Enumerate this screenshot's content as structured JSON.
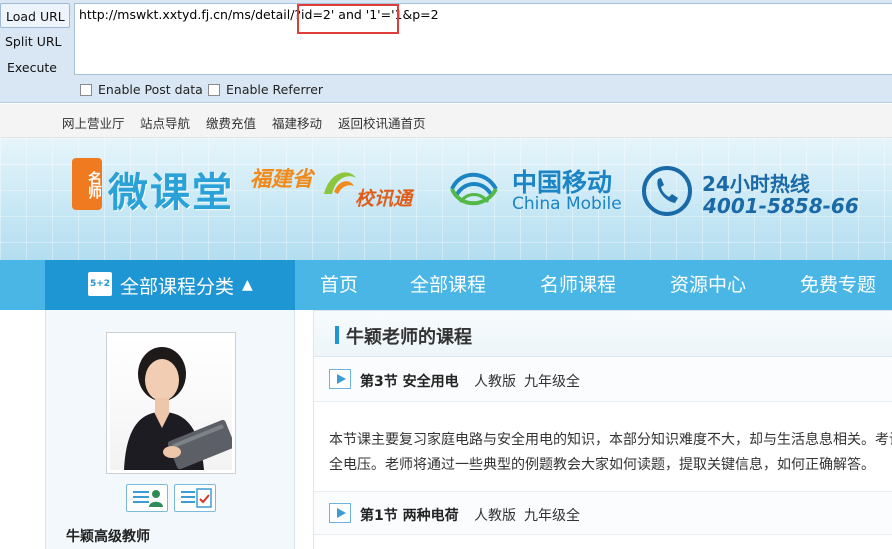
{
  "hackbar": {
    "buttons": [
      "Load URL",
      "Split URL",
      "Execute"
    ],
    "url": "http://mswkt.xxtyd.fj.cn/ms/detail/?id=2' and  '1'='1&p=2",
    "options": [
      "Enable Post data",
      "Enable Referrer"
    ]
  },
  "toplinks": [
    "网上营业厅",
    "站点导航",
    "缴费充值",
    "福建移动",
    "返回校讯通首页"
  ],
  "banner": {
    "logo_badge": "名师",
    "logo_main": "微课堂",
    "fujian_1": "福建省",
    "fujian_2": "校讯通",
    "cmcc_cn": "中国移动",
    "cmcc_en": "China Mobile",
    "hotline_title": "24小时热线",
    "hotline_number": "4001-5858-66"
  },
  "nav": {
    "category_icon_text": "5+2",
    "category_label": "全部课程分类",
    "category_arrow": "▲",
    "items": [
      "首页",
      "全部课程",
      "名师课程",
      "资源中心",
      "免费专题"
    ]
  },
  "teacher": {
    "name": "牛颖高级教师"
  },
  "content": {
    "title": "牛颖老师的课程",
    "lessons": [
      {
        "title": "第3节 安全用电",
        "publisher": "人教版",
        "grade": "九年级全"
      },
      {
        "title": "第1节 两种电荷",
        "publisher": "人教版",
        "grade": "九年级全"
      }
    ],
    "description_lines": [
      "本节课主要复习家庭电路与安全用电的知识，本部分知识难度不大，却与生活息息相关。考试",
      "全电压。老师将通过一些典型的例题教会大家如何读题，提取关键信息，如何正确解答。"
    ]
  },
  "colors": {
    "nav_bg": "#4ab6e6",
    "nav_active": "#1f96d4",
    "highlight_box": "#e03c3c",
    "cmcc_blue": "#1b84c4",
    "logo_orange": "#f07a1f"
  }
}
